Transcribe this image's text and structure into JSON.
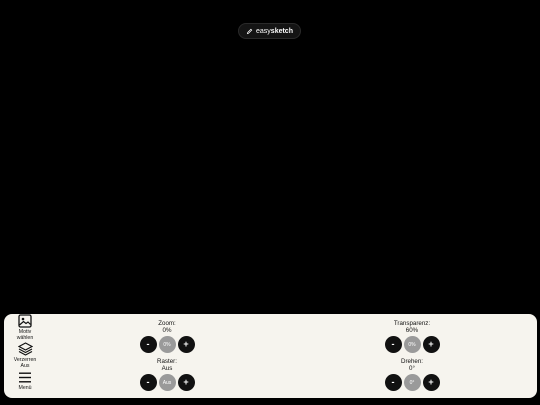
{
  "brand": {
    "prefix": "easy",
    "suffix": "sketch",
    "icon": "pencil-icon"
  },
  "sidebar": {
    "items": [
      {
        "label_line1": "Motiv",
        "label_line2": "wählen",
        "icon": "image-icon"
      },
      {
        "label_line1": "Verzerren",
        "label_line2": "Aus",
        "icon": "layers-icon"
      },
      {
        "label_line1": "Menü",
        "label_line2": "",
        "icon": "hamburger-menu-icon"
      }
    ]
  },
  "controls": {
    "zoom": {
      "label": "Zoom:",
      "value": "0%",
      "circle": "0%",
      "minus": "-",
      "plus": "+"
    },
    "raster": {
      "label": "Raster:",
      "value": "Aus",
      "circle": "Aus",
      "minus": "-",
      "plus": "+"
    },
    "transparenz": {
      "label": "Transparenz:",
      "value": "60%",
      "circle": "0%",
      "minus": "-",
      "plus": "+"
    },
    "drehen": {
      "label": "Drehen:",
      "value": "0°",
      "circle": "0°",
      "minus": "-",
      "plus": "+"
    }
  },
  "colors": {
    "background": "#000000",
    "panel": "#f6f4ee",
    "button": "#111111",
    "value_circle": "#9a9a9a"
  }
}
